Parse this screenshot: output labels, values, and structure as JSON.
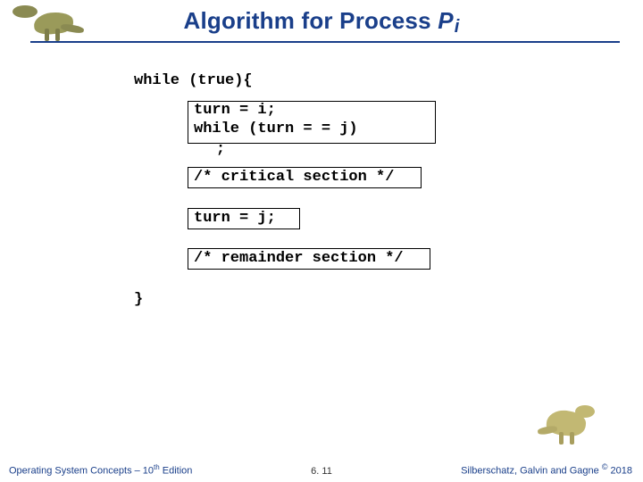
{
  "slide": {
    "title_main": "Algorithm for Process ",
    "title_proc": "P",
    "title_sub": "i"
  },
  "code": {
    "while_header": "while (true){",
    "box1_l1": "turn = i;",
    "box1_l2": "while (turn = = j)",
    "box1_trailing": ";",
    "box2": "/* critical section */",
    "box3": "turn = j;",
    "box4": "/* remainder section */",
    "close": "}"
  },
  "footer": {
    "left_prefix": "Operating System Concepts – 10",
    "left_th": "th",
    "left_suffix": " Edition",
    "center": "6. 11",
    "right_prefix": "Silberschatz, Galvin and Gagne ",
    "right_copy": "©",
    "right_year": " 2018"
  }
}
